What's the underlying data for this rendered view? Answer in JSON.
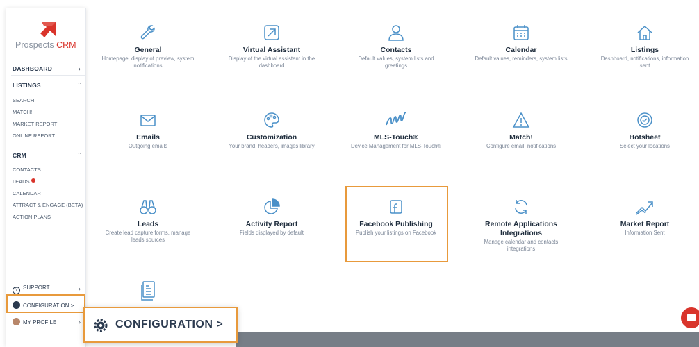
{
  "app": {
    "logo_prefix": "Prospects ",
    "logo_suffix": "CRM"
  },
  "sidebar": {
    "dashboard": "DASHBOARD",
    "listings": {
      "label": "LISTINGS",
      "items": [
        "SEARCH",
        "MATCH!",
        "MARKET REPORT",
        "ONLINE REPORT"
      ]
    },
    "crm": {
      "label": "CRM",
      "items": [
        "CONTACTS",
        "LEADS",
        "CALENDAR",
        "ATTRACT & ENGAGE (BETA)",
        "ACTION PLANS"
      ]
    },
    "support": "SUPPORT",
    "configuration": "CONFIGURATION >",
    "my_profile": "MY PROFILE"
  },
  "tiles": [
    {
      "icon": "wrench-icon",
      "title": "General",
      "desc": "Homepage, display of preview, system notifications"
    },
    {
      "icon": "assistant-arrow-icon",
      "title": "Virtual Assistant",
      "desc": "Display of the virtual assistant in the dashboard"
    },
    {
      "icon": "user-icon",
      "title": "Contacts",
      "desc": "Default values, system lists and greetings"
    },
    {
      "icon": "calendar-icon",
      "title": "Calendar",
      "desc": "Default values, reminders, system lists"
    },
    {
      "icon": "house-icon",
      "title": "Listings",
      "desc": "Dashboard, notifications, information sent"
    },
    {
      "icon": "envelope-icon",
      "title": "Emails",
      "desc": "Outgoing emails"
    },
    {
      "icon": "palette-icon",
      "title": "Customization",
      "desc": "Your brand, headers, images library"
    },
    {
      "icon": "mls-touch-icon",
      "title": "MLS-Touch®",
      "desc": "Device Management for MLS-Touch®"
    },
    {
      "icon": "warning-icon",
      "title": "Match!",
      "desc": "Configure email, notifications"
    },
    {
      "icon": "target-icon",
      "title": "Hotsheet",
      "desc": "Select your locations"
    },
    {
      "icon": "binoculars-icon",
      "title": "Leads",
      "desc": "Create lead capture forms, manage leads sources"
    },
    {
      "icon": "pie-chart-icon",
      "title": "Activity Report",
      "desc": "Fields displayed by default"
    },
    {
      "icon": "facebook-icon",
      "title": "Facebook Publishing",
      "desc": "Publish your listings on Facebook"
    },
    {
      "icon": "sync-icon",
      "title": "Remote Applications Integrations",
      "desc": "Manage calendar and contacts integrations"
    },
    {
      "icon": "trend-chart-icon",
      "title": "Market Report",
      "desc": "Information Sent"
    },
    {
      "icon": "document-icon",
      "title": "",
      "desc": ""
    }
  ],
  "popout": {
    "label": "CONFIGURATION >"
  },
  "colors": {
    "accent": "#e89a3c",
    "brand": "#d9342b",
    "icon": "#4a90c8"
  }
}
